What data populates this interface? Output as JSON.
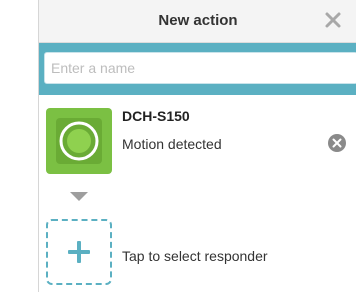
{
  "header": {
    "title": "New action",
    "close_icon": "close-x-icon"
  },
  "name_field": {
    "placeholder": "Enter a name",
    "value": ""
  },
  "trigger": {
    "device_name": "DCH-S150",
    "status": "Motion detected",
    "device_icon": "motion-sensor-icon",
    "remove_icon": "remove-circle-icon",
    "tile_color": "#7bc043"
  },
  "responder": {
    "label": "Tap to select responder",
    "icon": "plus-icon",
    "border_color": "#5bb0c2"
  },
  "colors": {
    "accent": "#5bb0c2",
    "device_green": "#7bc043",
    "header_bg": "#f4f4f4"
  }
}
